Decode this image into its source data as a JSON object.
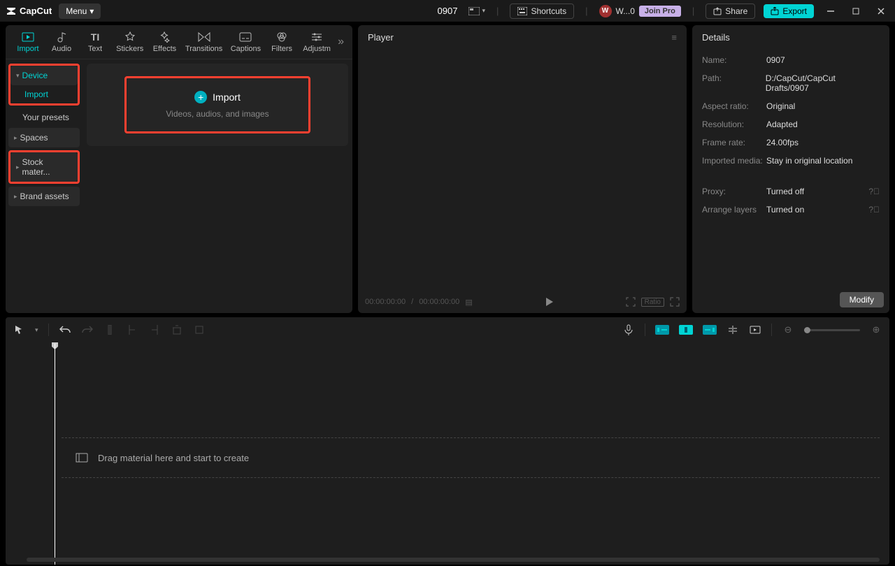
{
  "app": {
    "brand": "CapCut",
    "menu": "Menu",
    "title": "0907"
  },
  "titlebar": {
    "shortcuts": "Shortcuts",
    "user": "W...0",
    "joinpro": "Join Pro",
    "share": "Share",
    "export": "Export"
  },
  "tooltabs": [
    {
      "label": "Import",
      "active": true
    },
    {
      "label": "Audio"
    },
    {
      "label": "Text"
    },
    {
      "label": "Stickers"
    },
    {
      "label": "Effects"
    },
    {
      "label": "Transitions"
    },
    {
      "label": "Captions"
    },
    {
      "label": "Filters"
    },
    {
      "label": "Adjustm"
    }
  ],
  "sidebar": {
    "device": "Device",
    "import": "Import",
    "presets": "Your presets",
    "spaces": "Spaces",
    "stock": "Stock mater...",
    "brand": "Brand assets"
  },
  "importbox": {
    "title": "Import",
    "sub": "Videos, audios, and images"
  },
  "player": {
    "title": "Player",
    "time_left": "00:00:00:00",
    "time_right": "00:00:00:00",
    "ratio": "Ratio"
  },
  "details": {
    "title": "Details",
    "rows": {
      "name_l": "Name:",
      "name_v": "0907",
      "path_l": "Path:",
      "path_v": "D:/CapCut/CapCut Drafts/0907",
      "aspect_l": "Aspect ratio:",
      "aspect_v": "Original",
      "res_l": "Resolution:",
      "res_v": "Adapted",
      "fps_l": "Frame rate:",
      "fps_v": "24.00fps",
      "imp_l": "Imported media:",
      "imp_v": "Stay in original location",
      "proxy_l": "Proxy:",
      "proxy_v": "Turned off",
      "layers_l": "Arrange layers",
      "layers_v": "Turned on"
    },
    "modify": "Modify"
  },
  "timeline": {
    "drop": "Drag material here and start to create"
  }
}
